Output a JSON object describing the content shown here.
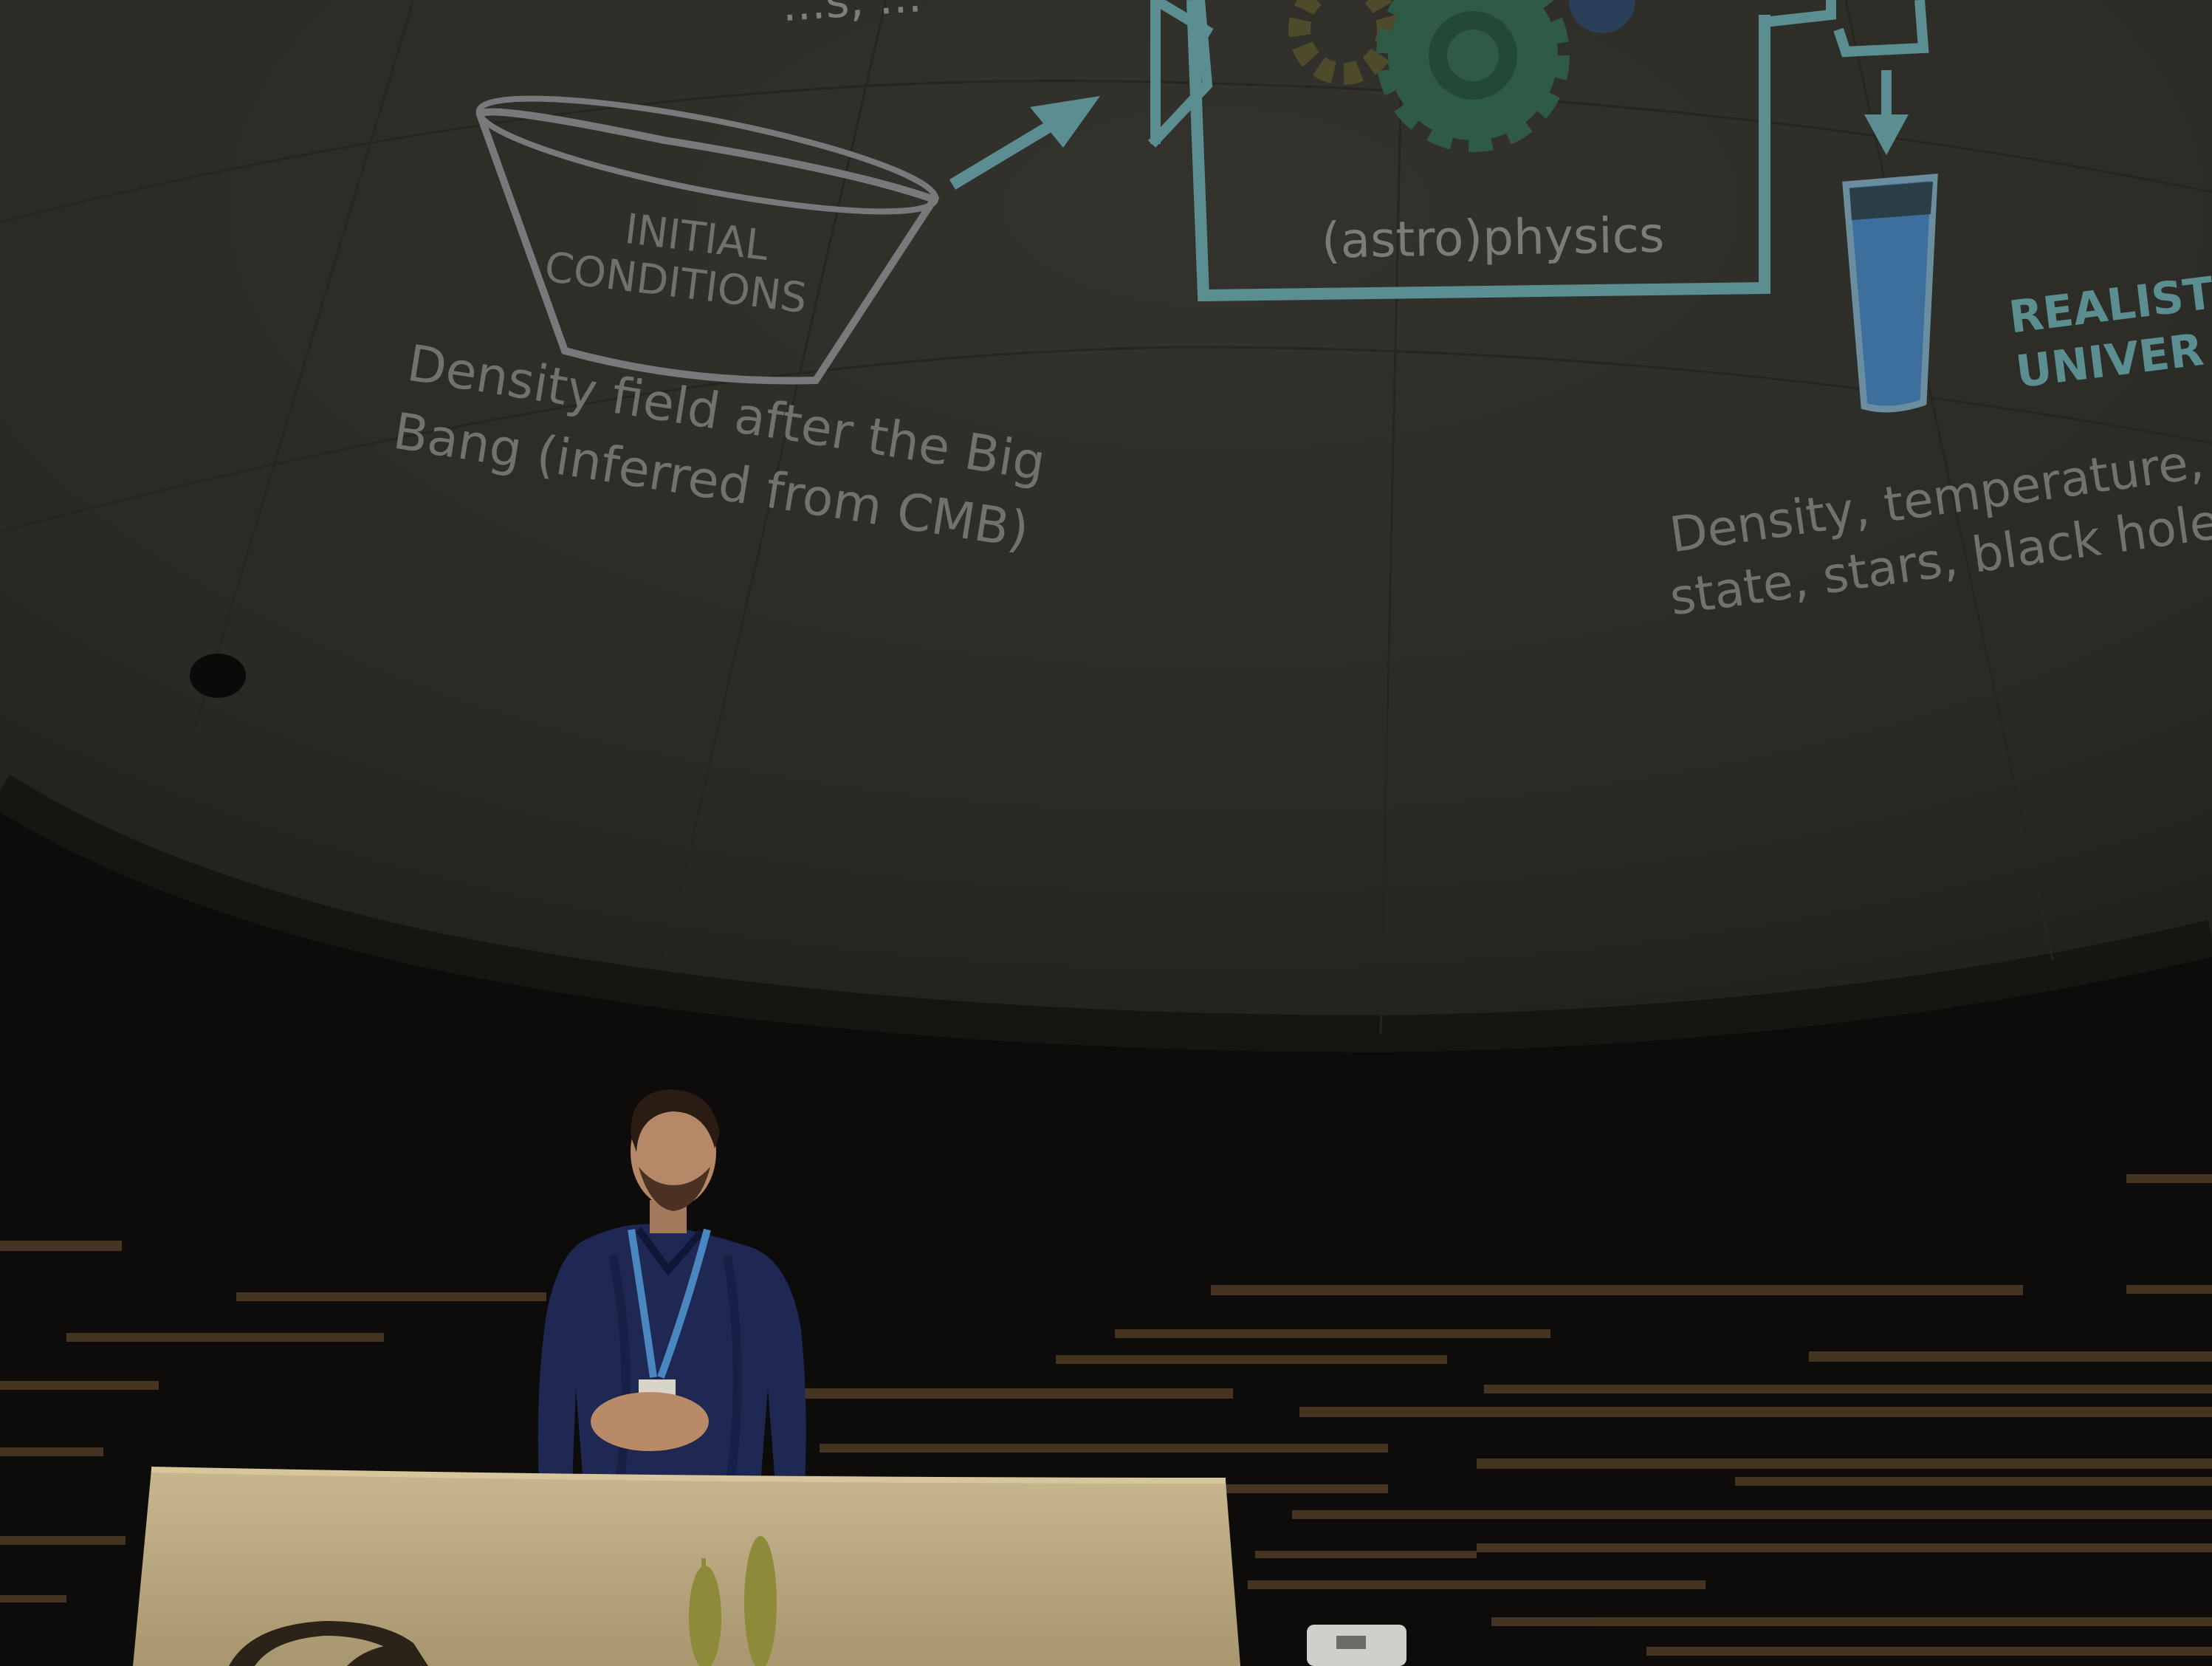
{
  "slide": {
    "top_fragment": "...s, ...",
    "initial_conditions_line1": "INITIAL",
    "initial_conditions_line2": "CONDITIONS",
    "initial_caption_line1": "Density field after the Big",
    "initial_caption_line2": "Bang (inferred from CMB)",
    "machine_label": "(astro)physics",
    "output_line1": "REALISTI",
    "output_line2": "UNIVER",
    "output_caption_line1": "Density, temperature, io",
    "output_caption_line2": "state, stars, black hole"
  },
  "colors": {
    "dome": "#2b2a25",
    "dome_edge": "#3a3832",
    "slide_text": "#7d7f7a",
    "accent_teal": "#5a8e91",
    "shirt": "#1f2a55",
    "lanyard": "#4a86c0",
    "lectern": "#bfae86",
    "wall": "#0f0e0c",
    "slat": "#4b3a23",
    "plant": "#8c8a3a"
  },
  "icons": {
    "gears": "gear-cluster-icon",
    "arrow_in": "arrow-right-icon",
    "arrow_down": "arrow-down-icon",
    "glass": "beer-glass-icon"
  }
}
